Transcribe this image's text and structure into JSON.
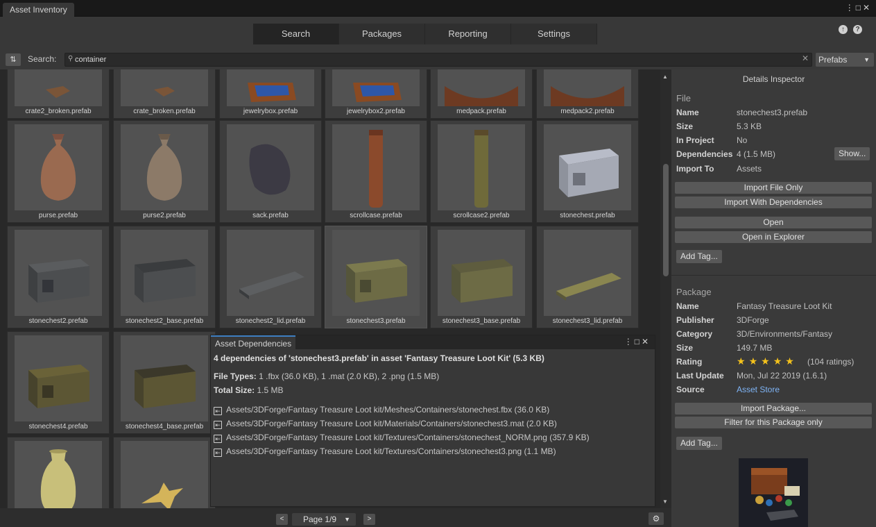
{
  "window": {
    "title": "Asset Inventory"
  },
  "tabs": [
    {
      "label": "Search",
      "active": true
    },
    {
      "label": "Packages",
      "active": false
    },
    {
      "label": "Reporting",
      "active": false
    },
    {
      "label": "Settings",
      "active": false
    }
  ],
  "search": {
    "label": "Search:",
    "value": "container",
    "type_filter": "Prefabs"
  },
  "assets": [
    "crate2_broken.prefab",
    "crate_broken.prefab",
    "jewelrybox.prefab",
    "jewelrybox2.prefab",
    "medpack.prefab",
    "medpack2.prefab",
    "purse.prefab",
    "purse2.prefab",
    "sack.prefab",
    "scrollcase.prefab",
    "scrollcase2.prefab",
    "stonechest.prefab",
    "stonechest2.prefab",
    "stonechest2_base.prefab",
    "stonechest2_lid.prefab",
    "stonechest3.prefab",
    "stonechest3_base.prefab",
    "stonechest3_lid.prefab",
    "stonechest4.prefab",
    "stonechest4_base.prefab"
  ],
  "pagination": {
    "page_label": "Page 1/9",
    "prev": "<",
    "next": ">"
  },
  "inspector": {
    "title": "Details Inspector",
    "file": {
      "section": "File",
      "name_key": "Name",
      "name": "stonechest3.prefab",
      "size_key": "Size",
      "size": "5.3 KB",
      "in_project_key": "In Project",
      "in_project": "No",
      "dependencies_key": "Dependencies",
      "dependencies": "4 (1.5 MB)",
      "show_button": "Show...",
      "import_to_key": "Import To",
      "import_to": "Assets",
      "btn_import_file": "Import File Only",
      "btn_import_deps": "Import With Dependencies",
      "btn_open": "Open",
      "btn_open_explorer": "Open in Explorer",
      "btn_add_tag": "Add Tag..."
    },
    "package": {
      "section": "Package",
      "name_key": "Name",
      "name": "Fantasy Treasure Loot Kit",
      "publisher_key": "Publisher",
      "publisher": "3DForge",
      "category_key": "Category",
      "category": "3D/Environments/Fantasy",
      "size_key": "Size",
      "size": "149.7 MB",
      "rating_key": "Rating",
      "rating_stars": 5,
      "rating_count": "(104 ratings)",
      "last_update_key": "Last Update",
      "last_update": "Mon, Jul 22 2019 (1.6.1)",
      "source_key": "Source",
      "source": "Asset Store",
      "btn_import_package": "Import Package...",
      "btn_filter": "Filter for this Package only",
      "btn_add_tag": "Add Tag..."
    }
  },
  "dependencies_window": {
    "tab": "Asset Dependencies",
    "heading": "4 dependencies of 'stonechest3.prefab' in asset 'Fantasy Treasure Loot Kit' (5.3 KB)",
    "file_types_key": "File Types:",
    "file_types": "1 .fbx (36.0 KB), 1 .mat (2.0 KB), 2 .png (1.5 MB)",
    "total_size_key": "Total Size:",
    "total_size": "1.5 MB",
    "items": [
      "Assets/3DForge/Fantasy Treasure Loot kit/Meshes/Containers/stonechest.fbx (36.0 KB)",
      "Assets/3DForge/Fantasy Treasure Loot kit/Materials/Containers/stonechest3.mat (2.0 KB)",
      "Assets/3DForge/Fantasy Treasure Loot kit/Textures/Containers/stonechest_NORM.png (357.9 KB)",
      "Assets/3DForge/Fantasy Treasure Loot kit/Textures/Containers/stonechest3.png (1.1 MB)"
    ]
  },
  "colors": {
    "accent": "#3e7fc2",
    "star": "#f4c21c",
    "link": "#7fb4f5"
  }
}
